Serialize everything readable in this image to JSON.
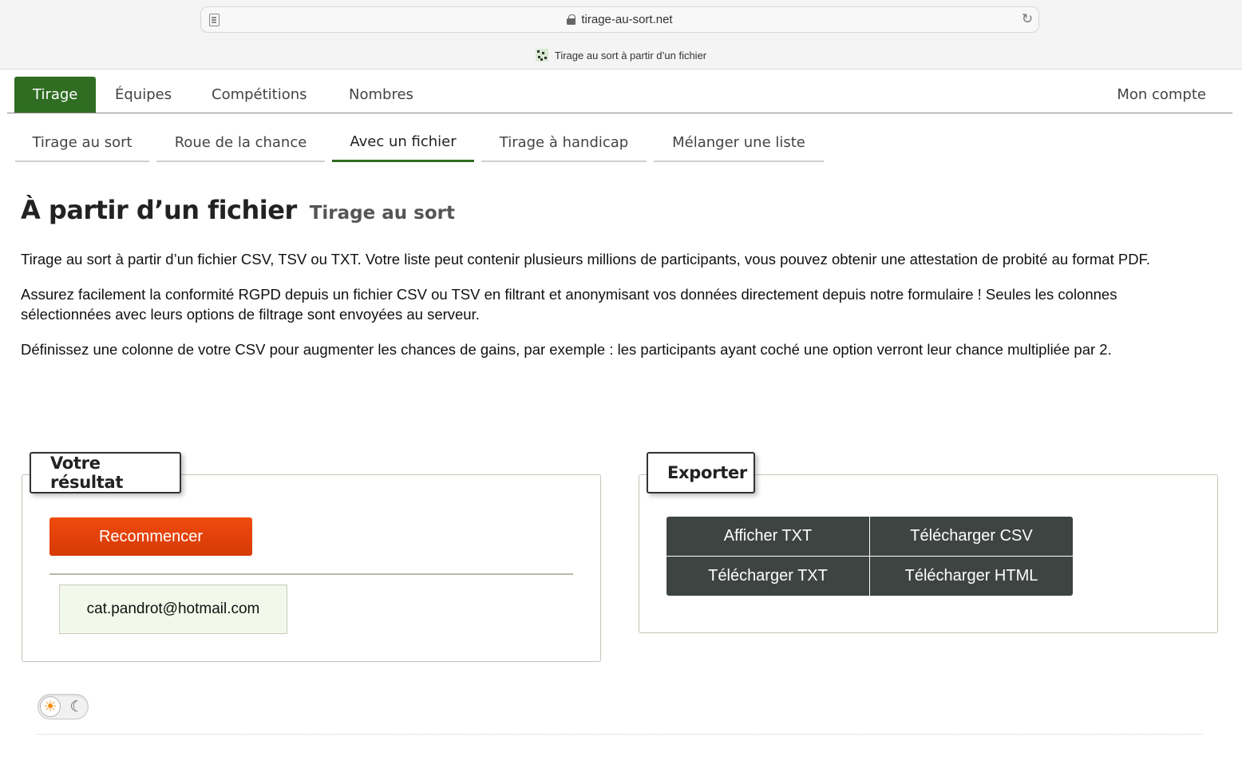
{
  "browser": {
    "url": "tirage-au-sort.net",
    "tab_title": "Tirage au sort à partir d’un fichier"
  },
  "main_nav": {
    "items": [
      "Tirage",
      "Équipes",
      "Compétitions",
      "Nombres"
    ],
    "account": "Mon compte"
  },
  "sub_nav": {
    "items": [
      "Tirage au sort",
      "Roue de la chance",
      "Avec un fichier",
      "Tirage à handicap",
      "Mélanger une liste"
    ],
    "active": "Avec un fichier"
  },
  "page": {
    "title": "À partir d’un fichier",
    "subtitle": "Tirage au sort",
    "paragraphs": [
      "Tirage au sort à partir d’un fichier CSV, TSV ou TXT. Votre liste peut contenir plusieurs millions de participants, vous pouvez obtenir une attestation de probité au format PDF.",
      "Assurez facilement la conformité RGPD depuis un fichier CSV ou TSV en filtrant et anonymisant vos données directement depuis notre formulaire ! Seules les colonnes sélectionnées avec leurs options de filtrage sont envoyées au serveur.",
      "Définissez une colonne de votre CSV pour augmenter les chances de gains, par exemple : les participants ayant coché une option verront leur chance multipliée par 2."
    ]
  },
  "result_panel": {
    "legend": "Votre résultat",
    "restart_label": "Recommencer",
    "winner": "cat.pandrot@hotmail.com"
  },
  "export_panel": {
    "legend": "Exporter",
    "buttons": [
      "Afficher TXT",
      "Télécharger CSV",
      "Télécharger TXT",
      "Télécharger HTML"
    ]
  },
  "theme_toggle": {
    "light_icon": "sun-icon",
    "dark_icon": "moon-icon",
    "selected": "light"
  },
  "colors": {
    "accent_green": "#2f6d22",
    "restart_orange": "#e5420b",
    "export_dark": "#3e4442",
    "result_bg": "#f3f9ea"
  }
}
